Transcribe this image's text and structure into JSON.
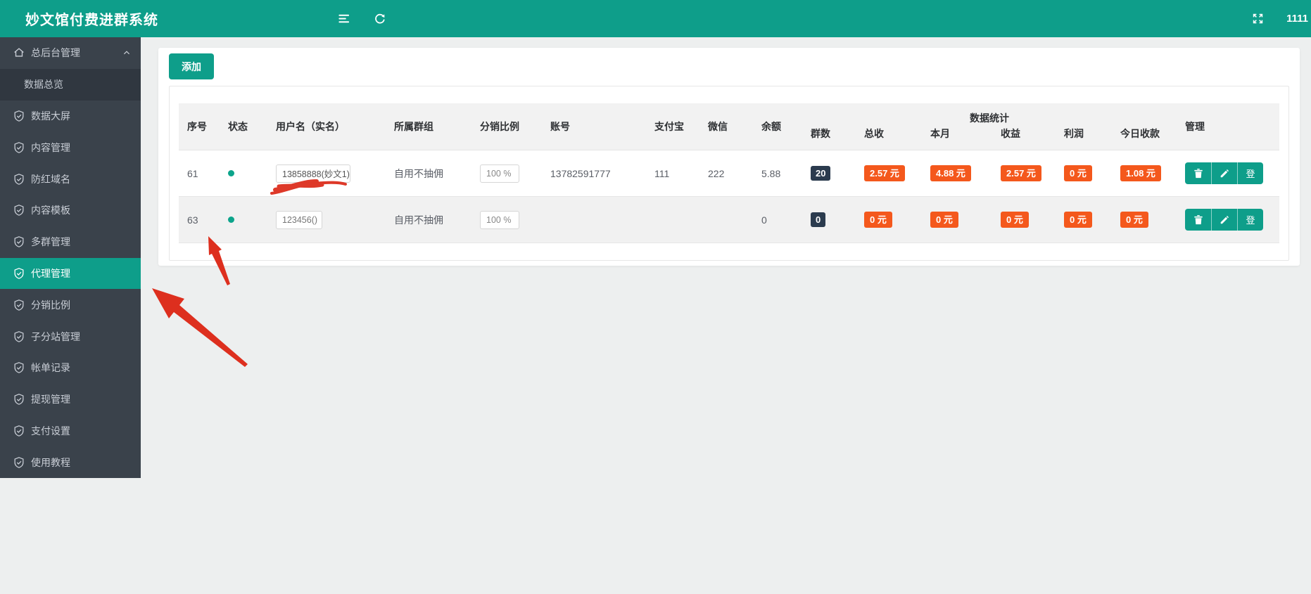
{
  "app": {
    "title": "妙文馆付费进群系统",
    "header_user": "1111"
  },
  "colors": {
    "accent_teal": "#0E9E8A",
    "sidebar_bg": "#3A424B",
    "sidebar_submenu_bg": "#303740",
    "orange_badge": "#F4581C",
    "dark_badge": "#2B3B4E",
    "annotation_red": "#DD2F1E",
    "content_bg": "#EDEFEF"
  },
  "header_icons": [
    "menu-fold-icon",
    "refresh-icon",
    "fullscreen-icon"
  ],
  "sidebar": {
    "items": [
      {
        "label": "总后台管理",
        "icon": "home-icon",
        "expanded": true
      },
      {
        "label": "数据总览",
        "submenu": true
      },
      {
        "label": "数据大屏",
        "icon": "shield-check-icon"
      },
      {
        "label": "内容管理",
        "icon": "shield-check-icon"
      },
      {
        "label": "防红域名",
        "icon": "shield-check-icon"
      },
      {
        "label": "内容模板",
        "icon": "shield-check-icon"
      },
      {
        "label": "多群管理",
        "icon": "shield-check-icon"
      },
      {
        "label": "代理管理",
        "icon": "shield-check-icon",
        "active": true
      },
      {
        "label": "分销比例",
        "icon": "shield-check-icon"
      },
      {
        "label": "子分站管理",
        "icon": "shield-check-icon"
      },
      {
        "label": "帐单记录",
        "icon": "shield-check-icon"
      },
      {
        "label": "提现管理",
        "icon": "shield-check-icon"
      },
      {
        "label": "支付设置",
        "icon": "shield-check-icon"
      },
      {
        "label": "使用教程",
        "icon": "shield-check-icon"
      }
    ]
  },
  "toolbar": {
    "add_button": "添加"
  },
  "table": {
    "headers": {
      "seq": "序号",
      "status": "状态",
      "username": "用户名（实名）",
      "group": "所属群组",
      "ratio": "分销比例",
      "account": "账号",
      "alipay": "支付宝",
      "wechat": "微信",
      "balance": "余额",
      "manage": "管理"
    },
    "stats_group": {
      "label": "数据统计",
      "sub": {
        "groups": "群数",
        "total": "总收",
        "month": "本月",
        "income": "收益",
        "profit": "利润",
        "today": "今日收款"
      }
    },
    "rows": [
      {
        "seq": "61",
        "status": "online",
        "username": "13858888(妙文1)",
        "group": "自用不抽佣",
        "ratio": "100 %",
        "account": "13782591777",
        "alipay": "111",
        "wechat": "222",
        "balance": "5.88",
        "groups": "20",
        "total": "2.57 元",
        "month": "4.88 元",
        "income": "2.57 元",
        "profit": "0 元",
        "today": "1.08 元"
      },
      {
        "seq": "63",
        "status": "online",
        "username": "123456()",
        "group": "自用不抽佣",
        "ratio": "100 %",
        "account": "",
        "alipay": "",
        "wechat": "",
        "balance": "0",
        "groups": "0",
        "total": "0 元",
        "month": "0 元",
        "income": "0 元",
        "profit": "0 元",
        "today": "0 元"
      }
    ],
    "actions": {
      "delete": "trash-icon",
      "edit": "pencil-icon",
      "login_label": "登"
    }
  },
  "annotations": {
    "arrow_color": "#DD2F1E",
    "marks": [
      "arrow-to-row-63",
      "arrow-to-sidebar-agent",
      "username-red-scribble"
    ]
  }
}
